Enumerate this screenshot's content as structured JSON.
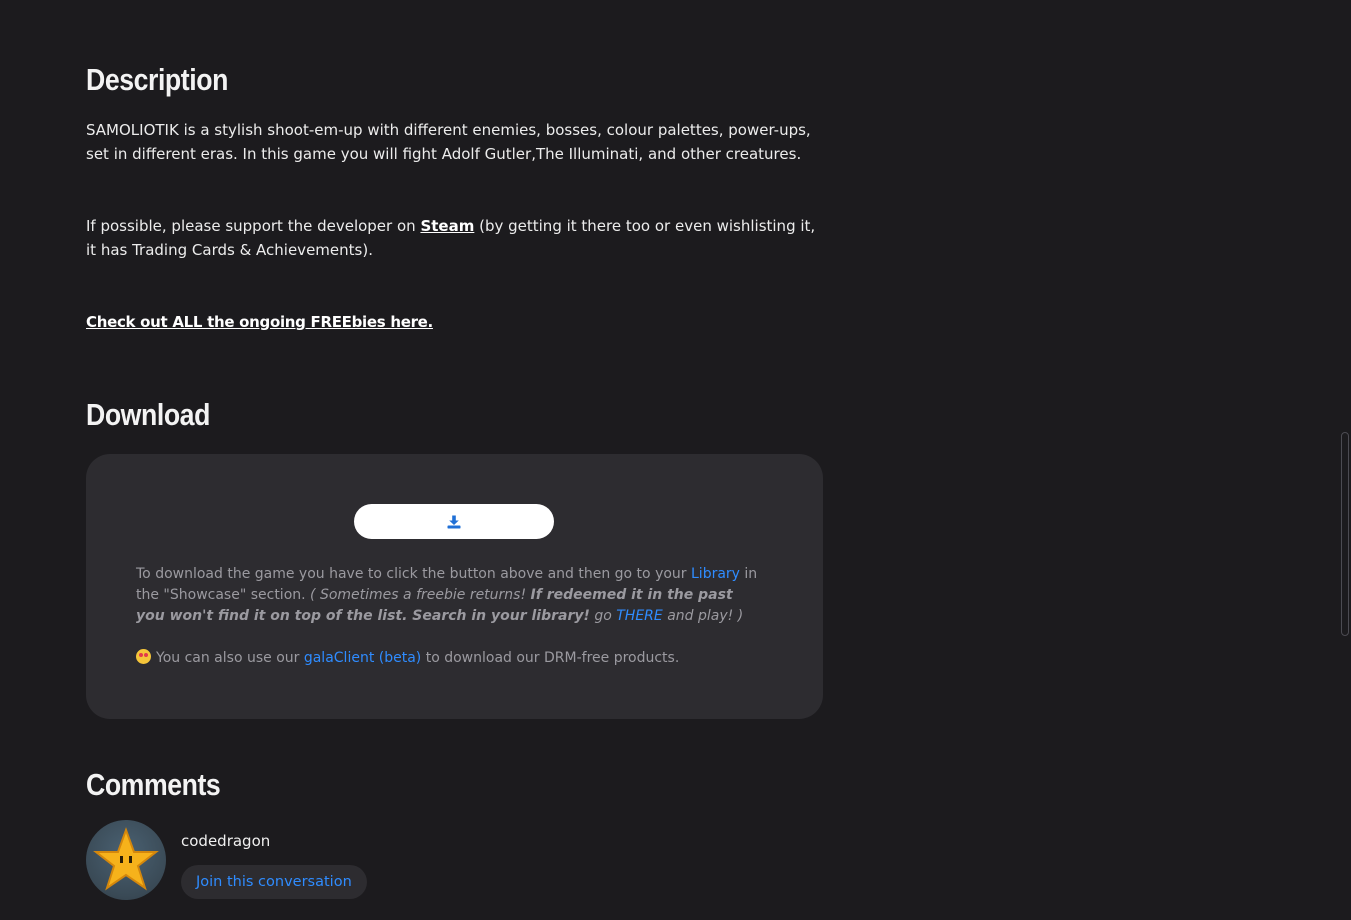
{
  "description": {
    "heading": "Description",
    "paragraph1": "SAMOLIOTIK is a stylish shoot-em-up with different enemies, bosses, colour palettes, power-ups, set in different eras. In this game you will fight Adolf Gutler,The Illuminati, and other creatures.",
    "support_before": "If possible, please support the developer on ",
    "support_link": "Steam",
    "support_after": " (by getting it there too or even wishlisting it, it has Trading Cards & Achievements).",
    "freebies_link": "Check out ALL the ongoing FREEbies here."
  },
  "download": {
    "heading": "Download",
    "button_icon": "download-icon",
    "note_part1": "To download the game you have to click the button above and then go to your ",
    "library_link": "Library",
    "note_part2": " in the \"Showcase\" section. ",
    "note_italic1": "( Sometimes a freebie returns! ",
    "note_bold_italic": "If redeemed it in the past you won't find it on top of the list. Search in your library!",
    "note_italic2": " go ",
    "there_link": "THERE",
    "note_italic3": " and play! )",
    "extra_before": "You can also use our ",
    "galaclient_link": "galaClient (beta)",
    "extra_after": " to download our DRM-free products."
  },
  "comments": {
    "heading": "Comments",
    "username": "codedragon",
    "join_button": "Join this conversation"
  },
  "colors": {
    "background": "#1c1b1e",
    "panel": "#2d2c30",
    "link": "#2f8cff"
  }
}
